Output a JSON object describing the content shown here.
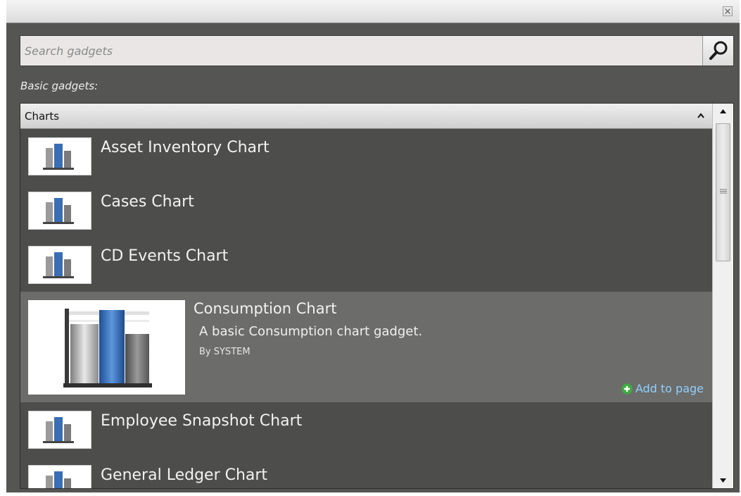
{
  "search": {
    "placeholder": "Search gadgets"
  },
  "section_label": "Basic gadgets:",
  "category": {
    "label": "Charts"
  },
  "gadgets": [
    {
      "title": "Asset Inventory Chart"
    },
    {
      "title": "Cases Chart"
    },
    {
      "title": "CD Events Chart"
    },
    {
      "title": "Consumption Chart",
      "description": "A basic Consumption chart gadget.",
      "author": "By SYSTEM",
      "action_label": "Add to page"
    },
    {
      "title": "Employee Snapshot Chart"
    },
    {
      "title": "General Ledger Chart"
    }
  ],
  "icons": {
    "close": "close-icon",
    "search": "search-icon",
    "collapse": "chevron-up-icon",
    "add": "plus-circle-icon",
    "thumbnail": "bar-chart-thumbnail-icon"
  },
  "colors": {
    "panel_bg": "#555553",
    "selected_row_bg": "#6c6c6a",
    "link": "#8fd0ff",
    "add_icon": "#3fae3f"
  }
}
